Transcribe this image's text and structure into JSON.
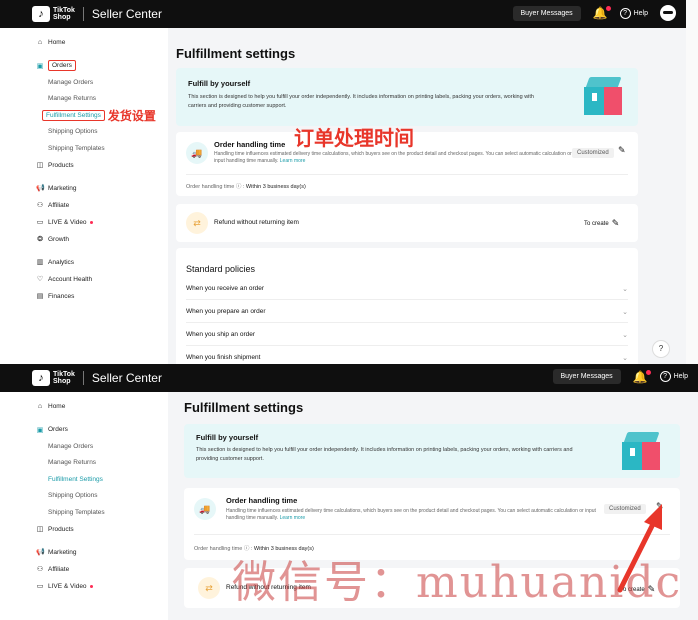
{
  "app": {
    "brand": "TikTok Shop",
    "brand_line1": "TikTok",
    "brand_line2": "Shop",
    "center_label": "Seller Center"
  },
  "topbar": {
    "buyer_messages": "Buyer Messages",
    "help": "Help",
    "icons": [
      "bell-icon",
      "help-icon",
      "avatar"
    ]
  },
  "sidebar": {
    "home": "Home",
    "orders": "Orders",
    "manage_orders": "Manage Orders",
    "manage_returns": "Manage Returns",
    "fulfillment_settings": "Fulfillment Settings",
    "shipping_options": "Shipping Options",
    "shipping_templates": "Shipping Templates",
    "products": "Products",
    "marketing": "Marketing",
    "affiliate": "Affiliate",
    "live_video": "LIVE & Video",
    "growth": "Growth",
    "analytics": "Analytics",
    "account_health": "Account Health",
    "finances": "Finances"
  },
  "main": {
    "page_title": "Fulfillment settings",
    "intro_title": "Fulfill by yourself",
    "intro_desc": "This section is designed to help you fulfill your order independently. It includes information on printing labels, packing your orders, working with carriers and providing customer support.",
    "order_handling_title": "Order handling time",
    "order_handling_desc": "Handling time influences estimated delivery time calculations, which buyers see on the product detail and checkout pages. You can select automatic calculation or input handling time manually.",
    "learn_more": "Learn more",
    "customized": "Customized",
    "order_handling_time_label": "Order handling time ⓘ :",
    "order_handling_time_value": "Within 3 business day(s)",
    "refund_title": "Refund without returning item",
    "to_create": "To create",
    "standard_policies": "Standard policies",
    "policies": [
      "When you receive an order",
      "When you prepare an order",
      "When you ship an order",
      "When you finish shipment"
    ]
  },
  "annotations": {
    "fulfillment_cn": "发货设置",
    "order_time_cn": "订单处理时间",
    "watermark": "微信号：muhuanidc"
  },
  "colors": {
    "accent": "#1a9ba8",
    "annotation_red": "#e8362a",
    "topbar": "#0f0f0f"
  }
}
